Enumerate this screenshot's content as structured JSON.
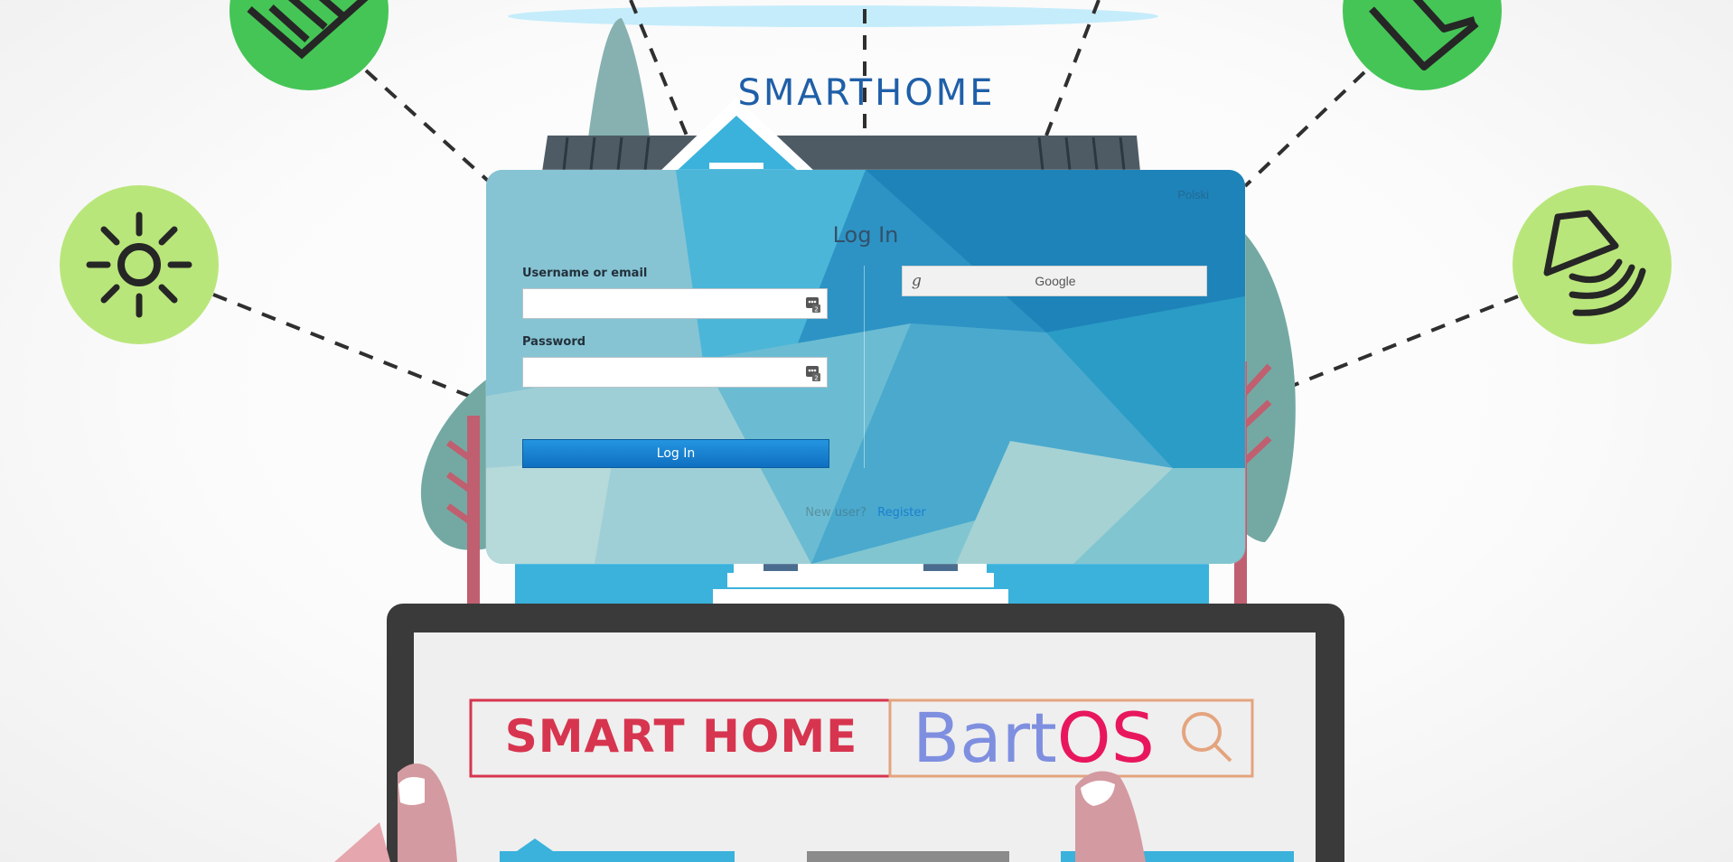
{
  "brand": {
    "title": "SMARTHOME"
  },
  "login": {
    "locale_label": "Polski",
    "title": "Log In",
    "username_label": "Username or email",
    "username_value": "",
    "password_label": "Password",
    "password_value": "",
    "submit_label": "Log In",
    "google_label": "Google",
    "google_glyph": "g",
    "new_user_text": "New user?",
    "register_label": "Register"
  },
  "background": {
    "banner_text": "SMART HOME",
    "banner_os_part1": "Bart",
    "banner_os_part2": "OS",
    "icons": [
      "trash-icon",
      "mail-icon",
      "sun-icon",
      "speaker-icon",
      "search-icon"
    ]
  },
  "colors": {
    "brand_blue": "#1f5fa8",
    "accent_green": "#45c556",
    "light_green": "#b9e67a",
    "house_blue": "#3ab2dc",
    "banner_red": "#d7354f",
    "banner_orange": "#e4a47e",
    "login_button": "#1579c9"
  }
}
